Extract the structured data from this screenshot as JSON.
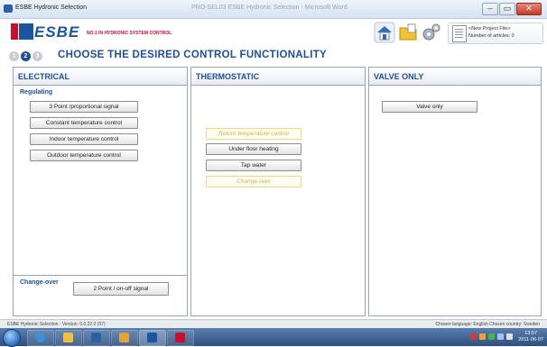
{
  "window": {
    "title": "ESBE Hydronic Selection",
    "background_title": "PRO-SEL03 ESBE Hydronic Selection - Microsoft Word"
  },
  "header": {
    "logo_text": "ESBE",
    "tagline": "NO.1 IN HYDRONIC SYSTEM CONTROL",
    "project": {
      "name": "<New Project File>",
      "articles": "Number of articles: 0"
    }
  },
  "steps": {
    "items": [
      "1",
      "2",
      "3"
    ],
    "active": 2,
    "title": "CHOOSE THE DESIRED CONTROL FUNCTIONALITY"
  },
  "panels": {
    "electrical": {
      "title": "ELECTRICAL",
      "regulating_label": "Regulating",
      "buttons": [
        "3 Point /proportional signal",
        "Constant temperature control",
        "Indoor temperature control",
        "Outdoor temperature control"
      ],
      "changeover_label": "Change-over",
      "changeover_button": "2 Point / on-off signal"
    },
    "thermostatic": {
      "title": "THERMOSTATIC",
      "buttons": [
        {
          "label": "Return temperature control",
          "enabled": false
        },
        {
          "label": "Under floor heating",
          "enabled": true
        },
        {
          "label": "Tap water",
          "enabled": true
        },
        {
          "label": "Change-over",
          "enabled": false
        }
      ]
    },
    "valve_only": {
      "title": "VALVE ONLY",
      "button": "Valve only"
    }
  },
  "statusbar": {
    "left": "ESBE Hydronic Selection - Version: 0.0.22.0 (57)",
    "right": "Chosen language: English  Chosen country: Sweden"
  },
  "taskbar": {
    "clock_time": "13:57",
    "clock_date": "2011-06-07"
  },
  "colors": {
    "brand_blue": "#1e4f98",
    "brand_red": "#c8102e",
    "disabled_text": "#c7b650"
  }
}
